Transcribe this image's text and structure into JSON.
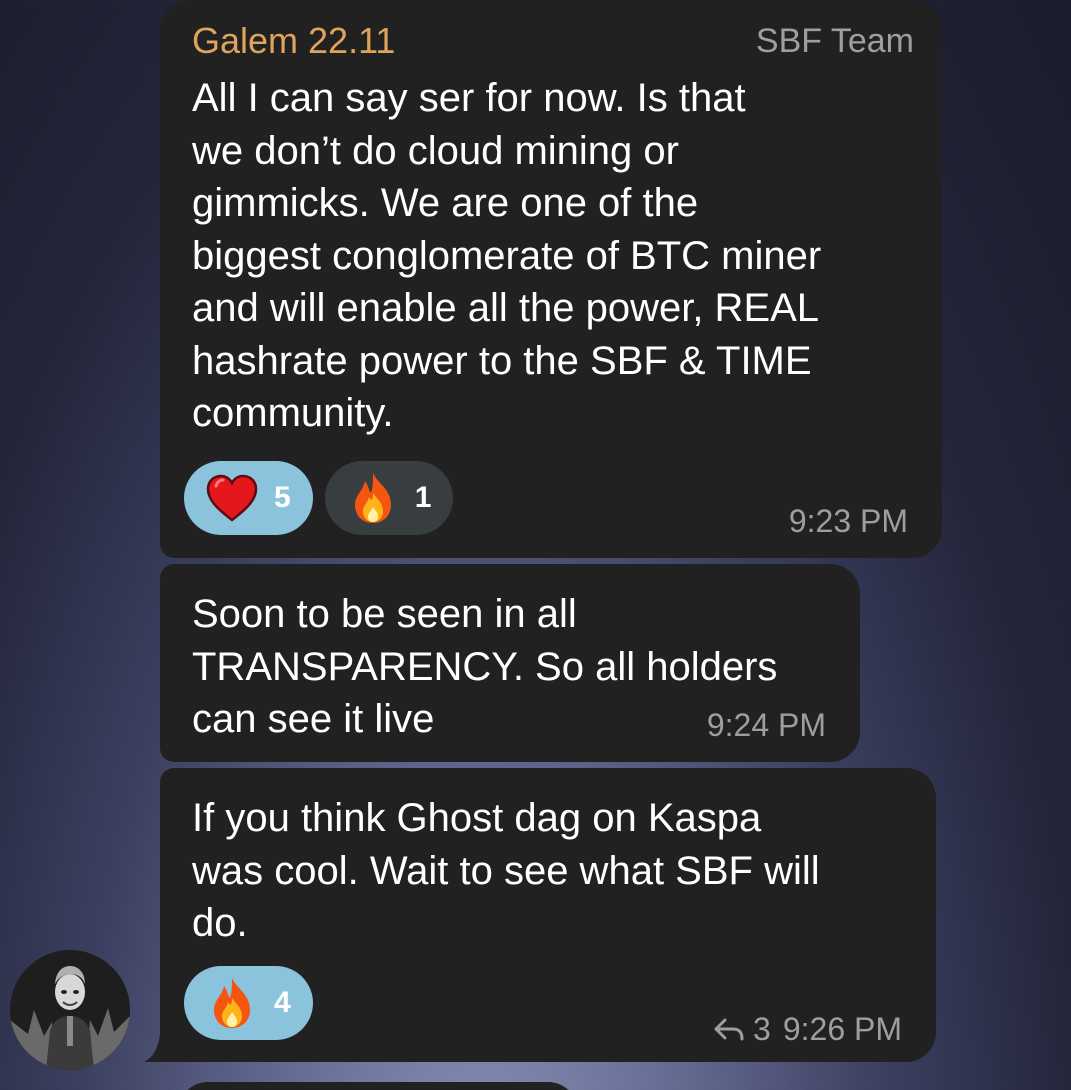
{
  "messages": [
    {
      "sender": "Galem 22.11",
      "sender_color": "#e0a35b",
      "tag": "SBF Team",
      "text": "All I can say ser for now. Is that\nwe don’t do cloud mining or\ngimmicks. We are one of the\nbiggest conglomerate of BTC miner\nand will enable all the power, REAL\nhashrate power to the SBF & TIME\ncommunity.",
      "reactions": [
        {
          "emoji": "heart",
          "count": "5",
          "chosen": true
        },
        {
          "emoji": "fire",
          "count": "1",
          "chosen": false
        }
      ],
      "time": "9:23 PM"
    },
    {
      "text": "Soon to be seen in all\nTRANSPARENCY. So all holders\ncan see it live",
      "time": "9:24 PM"
    },
    {
      "text": "If you think Ghost dag on Kaspa\nwas cool. Wait to see what SBF will\ndo.",
      "reactions": [
        {
          "emoji": "fire",
          "count": "4",
          "chosen": true
        }
      ],
      "replies": "3",
      "reply_icon": "reply-arrow-icon",
      "time": "9:26 PM"
    }
  ],
  "colors": {
    "bubble": "#212121",
    "chosen_reaction": "#8bc3dd",
    "other_reaction": "#383e40",
    "meta_text": "#9e9e9e"
  }
}
